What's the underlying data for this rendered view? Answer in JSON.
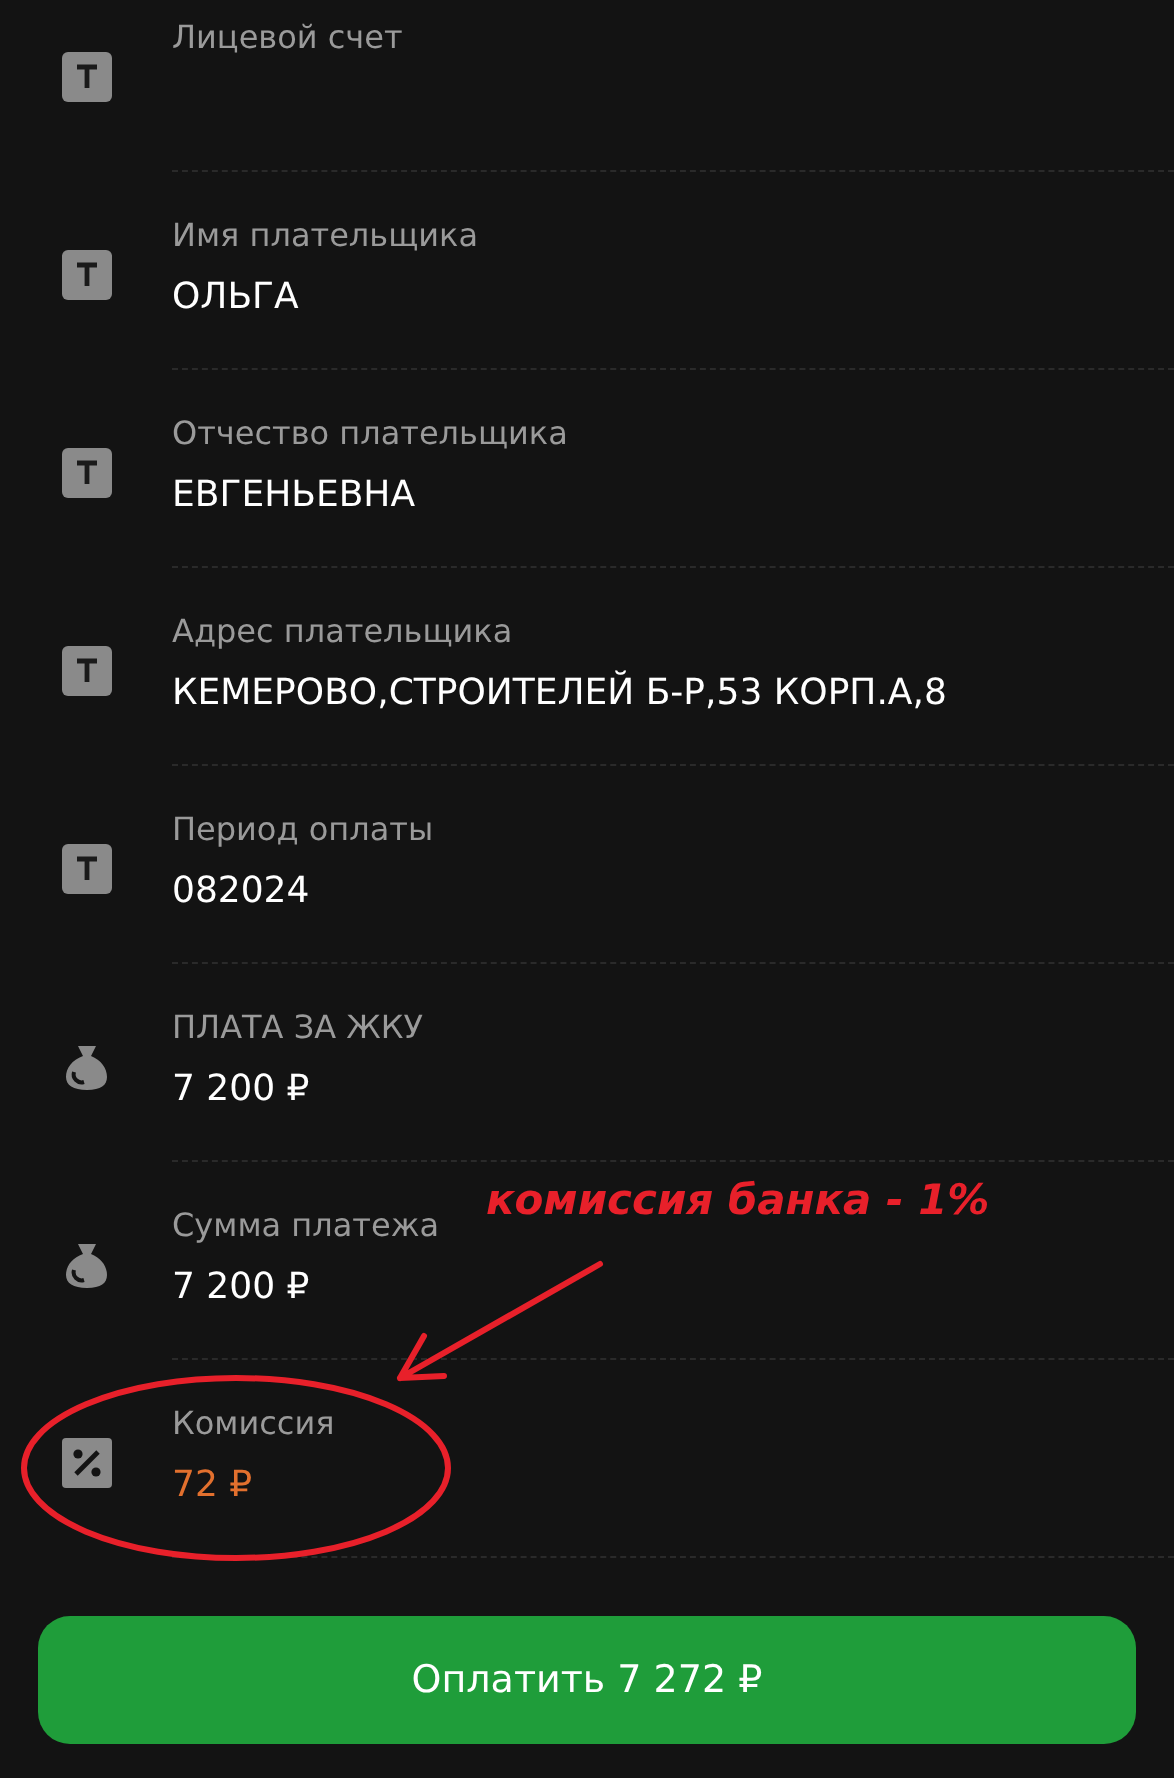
{
  "fields": [
    {
      "kind": "text",
      "label": "Лицевой счет"
    },
    {
      "kind": "text",
      "label": "Имя плательщика",
      "value": "ОЛЬГА"
    },
    {
      "kind": "text",
      "label": "Отчество плательщика",
      "value": "ЕВГЕНЬЕВНА"
    },
    {
      "kind": "text",
      "label": "Адрес плательщика",
      "value": "КЕМЕРОВО,СТРОИТЕЛЕЙ Б-Р,53 КОРП.А,8"
    },
    {
      "kind": "text",
      "label": "Период оплаты",
      "value": "082024"
    },
    {
      "kind": "amount",
      "label": "ПЛАТА ЗА ЖКУ",
      "value": "7 200 ₽"
    },
    {
      "kind": "amount",
      "label": "Сумма платежа",
      "value": "7 200 ₽"
    },
    {
      "kind": "fee",
      "label": "Комиссия",
      "value": "72 ₽"
    }
  ],
  "annotation": {
    "text": "комиссия банка - 1%"
  },
  "pay_button": "Оплатить 7 272 ₽"
}
